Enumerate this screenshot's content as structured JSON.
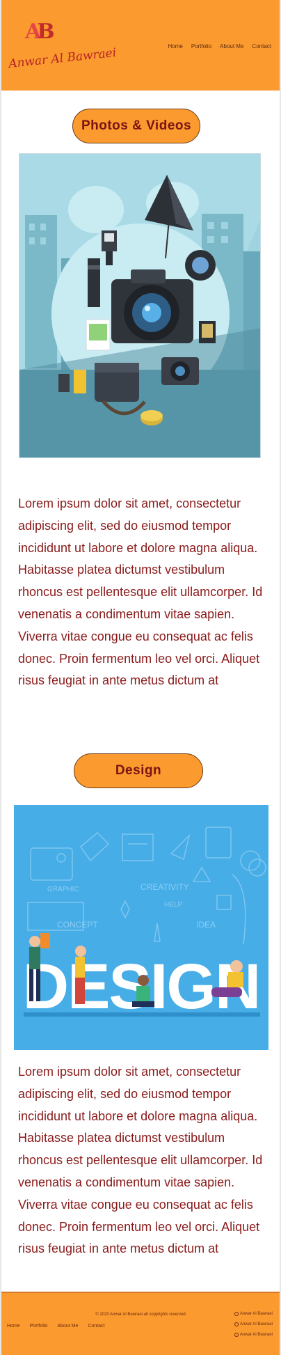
{
  "header": {
    "logo_monogram_a": "A",
    "logo_monogram_b": "B",
    "logo_script": "Anwar Al Bawraei",
    "nav": [
      "Home",
      "Portfolio",
      "About Me",
      "Contact"
    ]
  },
  "sections": [
    {
      "title": "Photos & Videos",
      "image_alt": "camera-equipment-illustration",
      "body": "Lorem ipsum dolor sit amet, consectetur adipiscing elit, sed do eiusmod tempor incididunt ut labore et dolore magna aliqua. Habitasse platea dictumst vestibulum rhoncus est pellentesque elit ullamcorper. Id venenatis a condimentum vitae sapien. Viverra vitae congue eu consequat ac felis donec. Proin fermentum leo vel orci. Aliquet risus feugiat in ante metus dictum at"
    },
    {
      "title": "Design",
      "image_alt": "design-illustration",
      "image_words": {
        "big": "DESIGN",
        "small": [
          "CREATIVITY",
          "CONCEPT",
          "IDEA",
          "HELP",
          "GRAPHIC"
        ]
      },
      "body": "Lorem ipsum dolor sit amet, consectetur adipiscing elit, sed do eiusmod tempor incididunt ut labore et dolore magna aliqua. Habitasse platea dictumst vestibulum rhoncus est pellentesque elit ullamcorper. Id venenatis a condimentum vitae sapien. Viverra vitae congue eu consequat ac felis donec. Proin fermentum leo vel orci. Aliquet risus feugiat in ante metus dictum at"
    }
  ],
  "footer": {
    "copyright": "© 2020 Anwar Al Bawraei all copyrights reserved",
    "nav": [
      "Home",
      "Portfolio",
      "About Me",
      "Contact"
    ],
    "social": [
      "Anwar Al Bawraei",
      "Anwar Al Bawraei",
      "Anwar Al Bawraei"
    ]
  },
  "colors": {
    "brand_orange": "#fb9a2f",
    "text_red": "#8a1a1a",
    "photo_bg": "#8fc9d9",
    "design_bg": "#47ade7"
  }
}
